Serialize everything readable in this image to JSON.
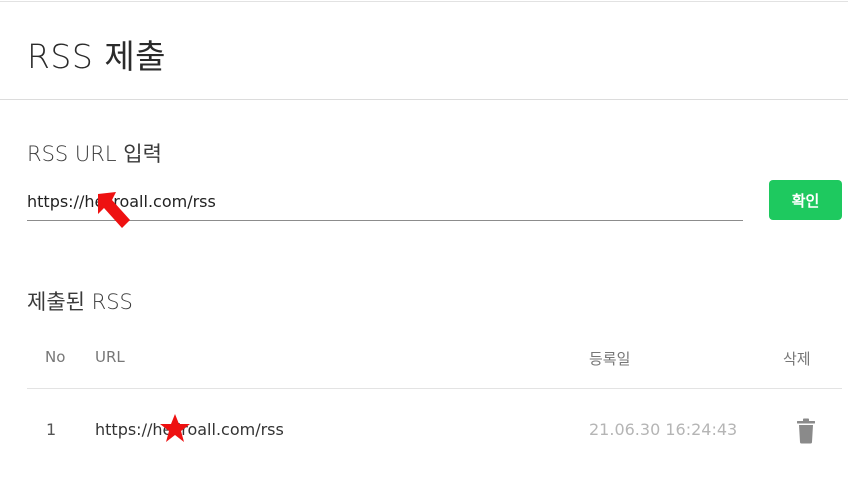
{
  "header": {
    "title": "RSS 제출"
  },
  "input_section": {
    "title": "RSS URL 입력",
    "url_value": "https://hellroall.com/rss",
    "confirm_label": "확인"
  },
  "submitted_section": {
    "title": "제출된 RSS",
    "columns": {
      "no": "No",
      "url": "URL",
      "date": "등록일",
      "delete": "삭제"
    },
    "rows": [
      {
        "no": "1",
        "url": "https://hellroall.com/rss",
        "date": "21.06.30 16:24:43"
      }
    ]
  },
  "colors": {
    "accent": "#1ec95f",
    "annotation": "#ee1111"
  },
  "icons": {
    "delete": "trash-icon"
  }
}
